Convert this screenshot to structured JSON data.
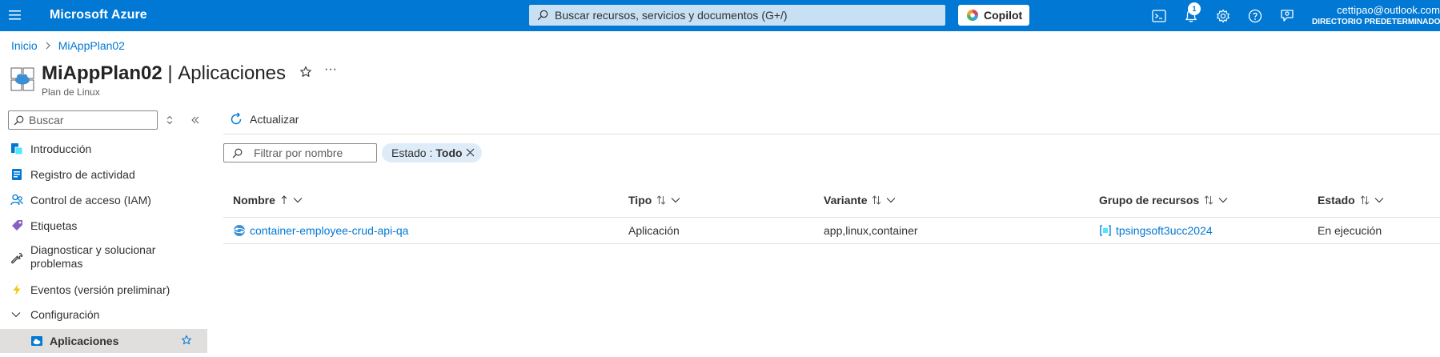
{
  "topbar": {
    "brand": "Microsoft Azure",
    "search_placeholder": "Buscar recursos, servicios y documentos (G+/)",
    "copilot_label": "Copilot",
    "notification_count": "1",
    "user_email": "cettipao@outlook.com",
    "user_directory": "DIRECTORIO PREDETERMINADO",
    "icons": [
      "menu-icon",
      "cloud-shell-icon",
      "bell-icon",
      "settings-icon",
      "help-icon",
      "feedback-icon"
    ]
  },
  "breadcrumb": {
    "items": [
      "Inicio",
      "MiAppPlan02"
    ]
  },
  "header": {
    "resource_name": "MiAppPlan02",
    "section": "Aplicaciones",
    "separator": " | ",
    "subtitle": "Plan de Linux",
    "more": "···"
  },
  "sidebar": {
    "search_placeholder": "Buscar",
    "items": [
      {
        "label": "Introducción",
        "icon": "overview-icon"
      },
      {
        "label": "Registro de actividad",
        "icon": "activity-log-icon"
      },
      {
        "label": "Control de acceso (IAM)",
        "icon": "iam-icon"
      },
      {
        "label": "Etiquetas",
        "icon": "tag-icon"
      },
      {
        "label": "Diagnosticar y solucionar",
        "label2": "problemas",
        "icon": "wrench-icon"
      },
      {
        "label": "Eventos (versión preliminar)",
        "icon": "lightning-icon"
      },
      {
        "label": "Configuración",
        "icon": "chevron-down-icon"
      },
      {
        "label": "Aplicaciones",
        "icon": "app-service-icon",
        "selected": true
      }
    ]
  },
  "toolbar": {
    "refresh_label": "Actualizar"
  },
  "filters": {
    "name_placeholder": "Filtrar por nombre",
    "state_label": "Estado :",
    "state_value": "Todo"
  },
  "table": {
    "columns": [
      "Nombre",
      "Tipo",
      "Variante",
      "Grupo de recursos",
      "Estado"
    ],
    "rows": [
      {
        "name": "container-employee-crud-api-qa",
        "type": "Aplicación",
        "variant": "app,linux,container",
        "resource_group": "tpsingsoft3ucc2024",
        "state": "En ejecución"
      }
    ]
  },
  "colors": {
    "accent": "#0078d4",
    "search_bg": "#c7e0f4",
    "selected_bg": "#e1dfdd",
    "pill_bg": "#deecf9"
  }
}
